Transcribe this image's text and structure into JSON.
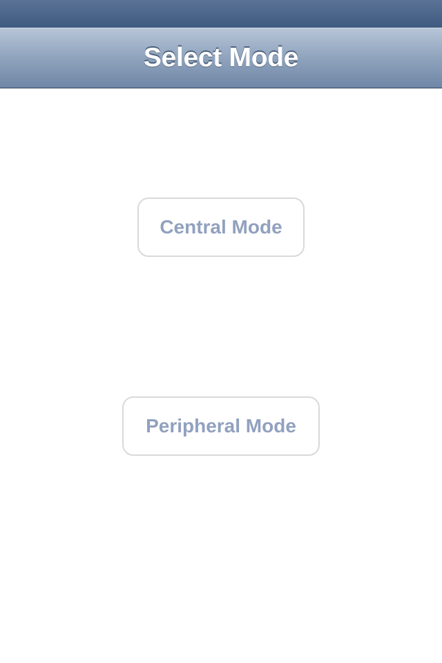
{
  "nav": {
    "title": "Select Mode"
  },
  "buttons": {
    "central_label": "Central Mode",
    "peripheral_label": "Peripheral Mode"
  },
  "colors": {
    "nav_gradient_top": "#b7c5d7",
    "nav_gradient_bottom": "#6f87a6",
    "status_bar": "#4a6589",
    "button_text": "#91a1bf",
    "button_border": "#d9d9d9"
  }
}
